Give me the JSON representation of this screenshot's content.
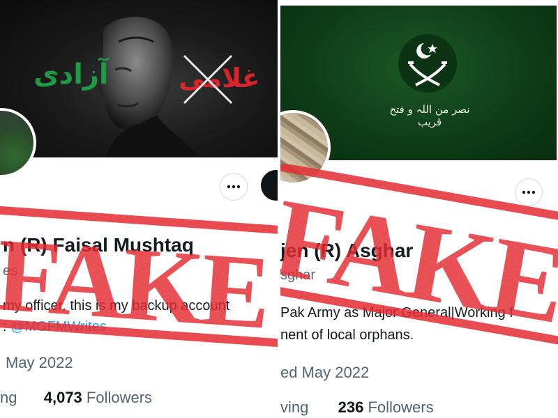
{
  "left_profile": {
    "banner": {
      "word_green": "آزادی",
      "word_red": "غلامی"
    },
    "display_name": "n (R) Faisal Mushtaq",
    "handle": "es",
    "bio_line1": "my officer. this is my backup account",
    "bio_line2_prefix": ":",
    "bio_mention": "@MGFMWrites",
    "joined": "May 2022",
    "following_label": "ng",
    "followers_count": "4,073",
    "followers_label": "Followers",
    "stamp_text": "FAKE"
  },
  "right_profile": {
    "banner": {
      "motto": "نصر من اللہ و فتح قریب"
    },
    "display_name": "jen (R) Asghar",
    "handle": "sghar",
    "bio_line1": "Pak Army as Major General|Working f",
    "bio_line2": "nent of local orphans.",
    "joined": "ed May 2022",
    "following_label": "ving",
    "followers_count": "236",
    "followers_label": "Followers",
    "stamp_text": "FAKE"
  },
  "icons": {
    "more": "more-horizontal-icon",
    "emblem": "crescent-star-swords-emblem"
  },
  "colors": {
    "stamp_red": "#e3262b",
    "link_blue": "#1d9bf0",
    "urdu_green": "#1f9a45",
    "army_green": "#0f3d17"
  }
}
